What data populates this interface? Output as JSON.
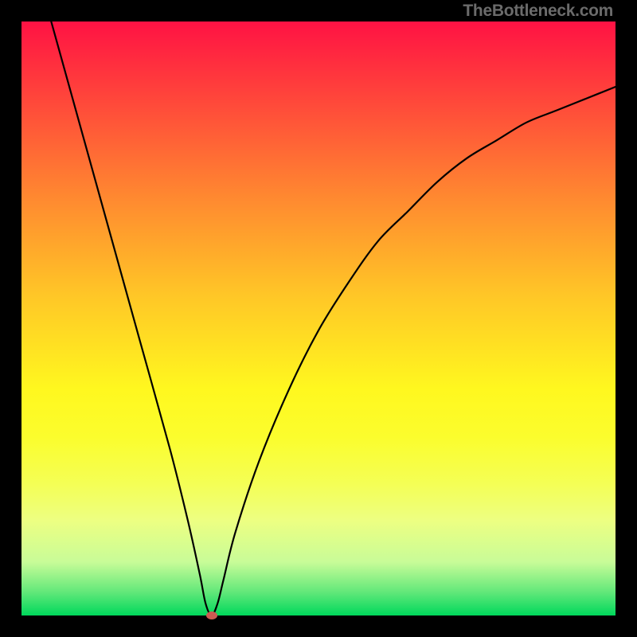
{
  "watermark": "TheBottleneck.com",
  "chart_data": {
    "type": "line",
    "title": "",
    "xlabel": "",
    "ylabel": "",
    "xlim": [
      0,
      100
    ],
    "ylim": [
      0,
      100
    ],
    "grid": false,
    "legend": false,
    "background_gradient": {
      "top": "#ff1244",
      "mid": "#fff81f",
      "bottom": "#00d85c"
    },
    "series": [
      {
        "name": "bottleneck-curve",
        "color": "#000000",
        "x": [
          5,
          10,
          15,
          20,
          25,
          28,
          30,
          31,
          32,
          33,
          34,
          36,
          40,
          45,
          50,
          55,
          60,
          65,
          70,
          75,
          80,
          85,
          90,
          95,
          100
        ],
        "y": [
          100,
          82,
          64,
          46,
          28,
          16,
          7,
          2,
          0,
          2,
          6,
          14,
          26,
          38,
          48,
          56,
          63,
          68,
          73,
          77,
          80,
          83,
          85,
          87,
          89
        ]
      }
    ],
    "marker": {
      "name": "optimal-point",
      "x": 32,
      "y": 0,
      "color": "#cc5a52"
    }
  }
}
